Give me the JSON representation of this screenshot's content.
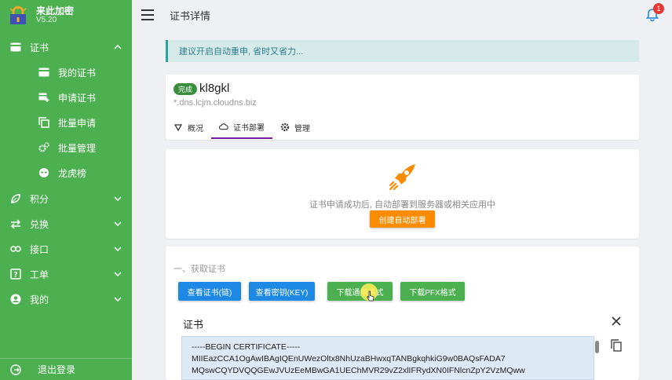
{
  "app": {
    "name": "来此加密",
    "version": "V5.20"
  },
  "sidebar": {
    "items": [
      {
        "label": "证书",
        "icon": "card-icon",
        "expanded": true
      },
      {
        "label": "我的证书",
        "icon": "card-icon"
      },
      {
        "label": "申请证书",
        "icon": "add-card-icon"
      },
      {
        "label": "批量申请",
        "icon": "copy-icon"
      },
      {
        "label": "批量管理",
        "icon": "gears-icon"
      },
      {
        "label": "龙虎榜",
        "icon": "alien-icon"
      },
      {
        "label": "积分",
        "icon": "leaf-icon"
      },
      {
        "label": "兑换",
        "icon": "swap-icon"
      },
      {
        "label": "接口",
        "icon": "link-icon"
      },
      {
        "label": "工单",
        "icon": "help-box-icon"
      },
      {
        "label": "我的",
        "icon": "account-icon"
      }
    ],
    "logout": "退出登录"
  },
  "header": {
    "title": "证书详情",
    "notification_count": "1"
  },
  "notice": "建议开启自动重申, 省时又省力...",
  "cert": {
    "status": "完成",
    "name": "kl8gkl",
    "domain": "*.dns.lcjm.cloudns.biz"
  },
  "tabs": [
    {
      "label": "概况",
      "icon": "triangle-down-icon"
    },
    {
      "label": "证书部署",
      "icon": "cloud-icon",
      "active": true
    },
    {
      "label": "管理",
      "icon": "gear-icon"
    }
  ],
  "deploy": {
    "hint": "证书申请成功后, 自动部署到服务器或相关应用中",
    "button": "创建自动部署"
  },
  "download": {
    "section_title": "一、获取证书",
    "buttons": [
      "查看证书(链)",
      "查看密钥(KEY)",
      "下载通用格式",
      "下载PFX格式"
    ]
  },
  "cert_view": {
    "title": "证书",
    "lines": [
      "-----BEGIN CERTIFICATE-----",
      "MIIEazCCA1OgAwIBAgIQEnUWezOltx8NhUzaBHwxqTANBgkqhkiG9w0BAQsFADA7",
      "MQswCQYDVQQGEwJVUzEeMBwGA1UEChMVR29vZ2xlIFRydXN0IFNlcnZpY2VzMQww"
    ]
  },
  "colors": {
    "sidebar": "#4caf50",
    "accent_tab": "#7b1fa2",
    "orange": "#fb8c00",
    "blue": "#1e88e5"
  }
}
